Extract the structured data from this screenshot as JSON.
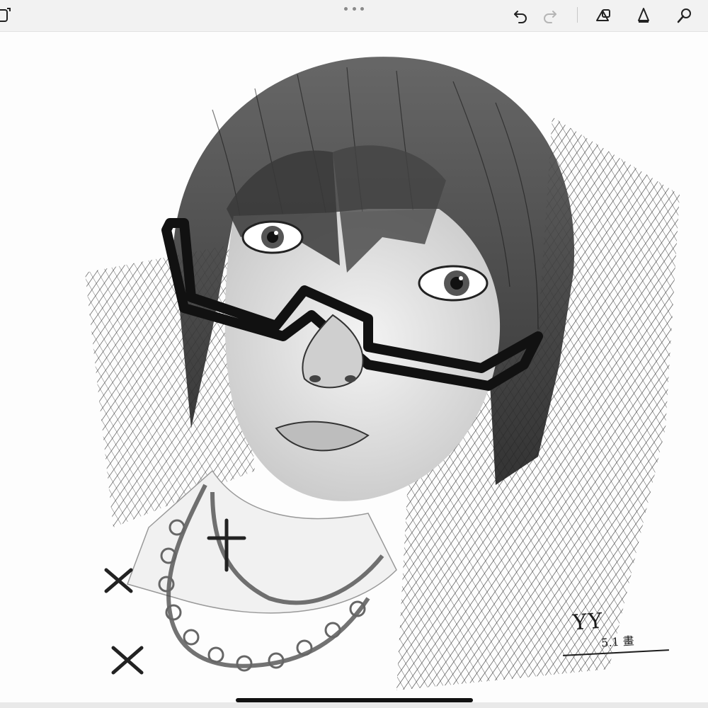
{
  "app": {
    "toolbar": {
      "left_icon": "layers-icon",
      "center_icon": "more-dots-icon",
      "right_icons": [
        "undo-icon",
        "redo-icon",
        "shapes-icon",
        "pencil-tool-icon",
        "smudge-tool-icon"
      ]
    },
    "canvas": {
      "artwork_subject_icon": "sketch-artwork",
      "signature": {
        "text": "YY",
        "date": "5.1 畫"
      }
    },
    "colors": {
      "toolbar_bg": "#f2f2f2",
      "icon": "#222222",
      "icon_disabled": "#b5b5b5",
      "ink": "#1c1c1c"
    }
  }
}
